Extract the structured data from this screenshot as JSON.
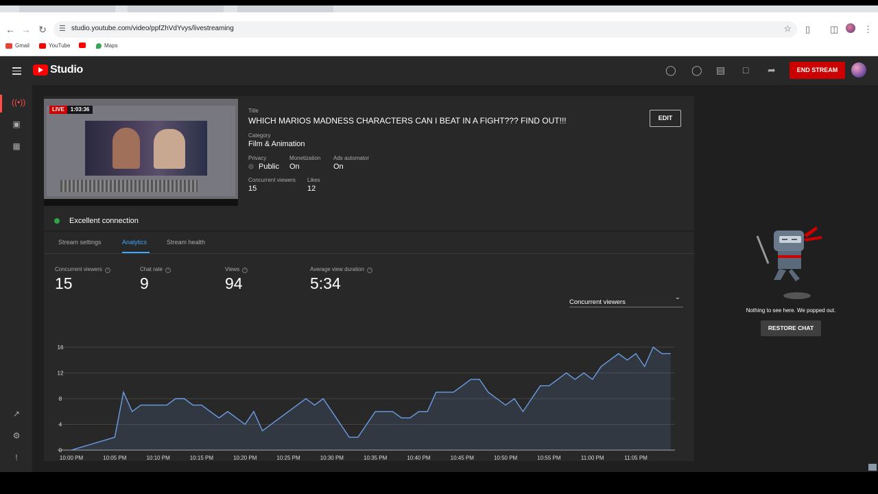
{
  "browser": {
    "url": "studio.youtube.com/video/ppfZhVdYvys/livestreaming",
    "bookmarks": [
      {
        "label": "Gmail",
        "icon": "gmail-icon",
        "color": "#ea4335"
      },
      {
        "label": "YouTube",
        "icon": "youtube-icon",
        "color": "#ff0000"
      },
      {
        "label": "",
        "icon": "youtube-icon",
        "color": "#ff0000"
      },
      {
        "label": "Maps",
        "icon": "maps-icon",
        "color": "#34a853"
      }
    ]
  },
  "header": {
    "app_name": "Studio",
    "end_stream_label": "END STREAM"
  },
  "stream": {
    "live_badge": "LIVE",
    "elapsed": "1:03:36",
    "connection": "Excellent connection",
    "title_label": "Title",
    "title": "WHICH MARIOS MADNESS CHARACTERS CAN I BEAT IN A FIGHT??? FIND OUT!!!",
    "edit_label": "EDIT",
    "category_label": "Category",
    "category": "Film & Animation",
    "privacy_label": "Privacy",
    "privacy": "Public",
    "monetization_label": "Monetization",
    "monetization": "On",
    "ads_label": "Ads automator",
    "ads": "On",
    "concurrent_label": "Concurrent viewers",
    "concurrent": "15",
    "likes_label": "Likes",
    "likes": "12"
  },
  "tabs": [
    {
      "label": "Stream settings",
      "active": false
    },
    {
      "label": "Analytics",
      "active": true
    },
    {
      "label": "Stream health",
      "active": false
    }
  ],
  "stats": [
    {
      "label": "Concurrent viewers",
      "value": "15"
    },
    {
      "label": "Chat rate",
      "value": "9"
    },
    {
      "label": "Views",
      "value": "94"
    },
    {
      "label": "Average view duration",
      "value": "5:34"
    }
  ],
  "metric_select": "Concurrent viewers",
  "chat": {
    "message": "Nothing to see here. We popped out.",
    "restore_label": "RESTORE CHAT"
  },
  "chart_data": {
    "type": "area",
    "title": "",
    "xlabel": "",
    "ylabel": "",
    "ylim": [
      0,
      16
    ],
    "yticks": [
      0,
      4,
      8,
      12,
      16
    ],
    "xticks": [
      "10:00 PM",
      "10:05 PM",
      "10:10 PM",
      "10:15 PM",
      "10:20 PM",
      "10:25 PM",
      "10:30 PM",
      "10:35 PM",
      "10:40 PM",
      "10:45 PM",
      "10:50 PM",
      "10:55 PM",
      "11:00 PM",
      "11:05 PM"
    ],
    "x_minutes_from_start": [
      0,
      5,
      6,
      7,
      8,
      9,
      10,
      11,
      12,
      13,
      14,
      15,
      16,
      17,
      18,
      19,
      20,
      21,
      22,
      23,
      24,
      25,
      26,
      27,
      28,
      29,
      30,
      31,
      32,
      33,
      34,
      35,
      36,
      37,
      38,
      39,
      40,
      41,
      42,
      43,
      44,
      45,
      46,
      47,
      48,
      49,
      50,
      51,
      52,
      53,
      54,
      55,
      56,
      57,
      58,
      59,
      60,
      61,
      62,
      63,
      64,
      65,
      66,
      67,
      68,
      69
    ],
    "values": [
      0,
      2,
      9,
      6,
      7,
      7,
      7,
      7,
      8,
      8,
      7,
      7,
      6,
      5,
      6,
      5,
      4,
      6,
      3,
      4,
      5,
      6,
      7,
      8,
      7,
      8,
      6,
      4,
      2,
      2,
      4,
      6,
      6,
      6,
      5,
      5,
      6,
      6,
      9,
      9,
      9,
      10,
      11,
      11,
      9,
      8,
      7,
      8,
      6,
      8,
      10,
      10,
      11,
      12,
      11,
      12,
      11,
      13,
      14,
      15,
      14,
      15,
      13,
      16,
      15,
      15
    ],
    "grid": true,
    "series_color": "#6c9ee6"
  }
}
